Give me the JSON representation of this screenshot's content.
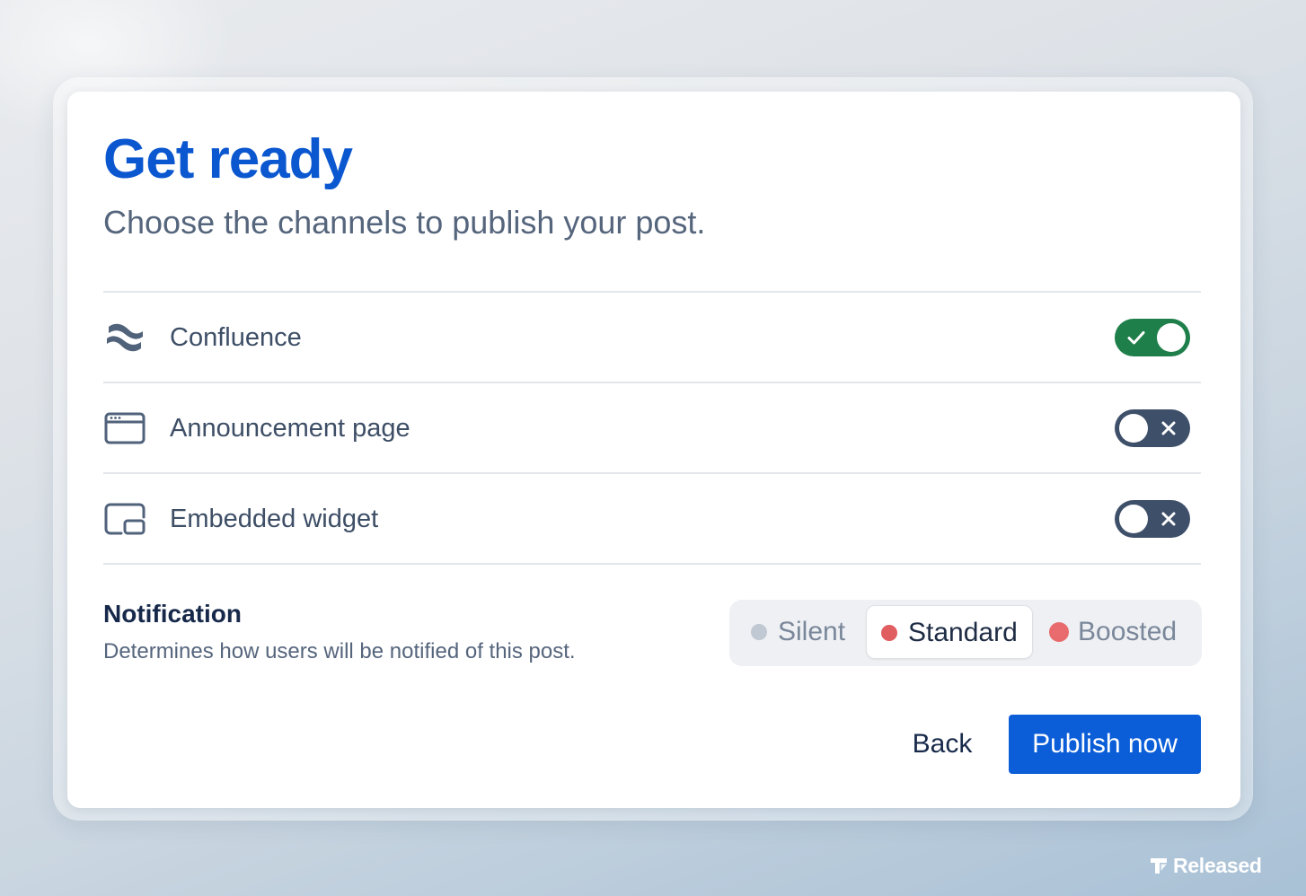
{
  "dialog": {
    "title": "Get ready",
    "subtitle": "Choose the channels to publish your post."
  },
  "channels": [
    {
      "label": "Confluence",
      "icon": "confluence-icon",
      "enabled": true
    },
    {
      "label": "Announcement page",
      "icon": "browser-window-icon",
      "enabled": false
    },
    {
      "label": "Embedded widget",
      "icon": "embedded-widget-icon",
      "enabled": false
    }
  ],
  "notification": {
    "title": "Notification",
    "description": "Determines how users will be notified of this post.",
    "options": [
      {
        "label": "Silent",
        "color": "#c0c8d3"
      },
      {
        "label": "Standard",
        "color": "#e05d60"
      },
      {
        "label": "Boosted",
        "color": "#e86b6e"
      }
    ],
    "selected": "Standard"
  },
  "actions": {
    "back_label": "Back",
    "publish_label": "Publish now"
  },
  "brand": {
    "name": "Released"
  },
  "colors": {
    "title": "#0b57d0",
    "primary_button": "#0b5ed8",
    "toggle_on": "#1f7f4b",
    "toggle_off": "#3e4f69"
  }
}
